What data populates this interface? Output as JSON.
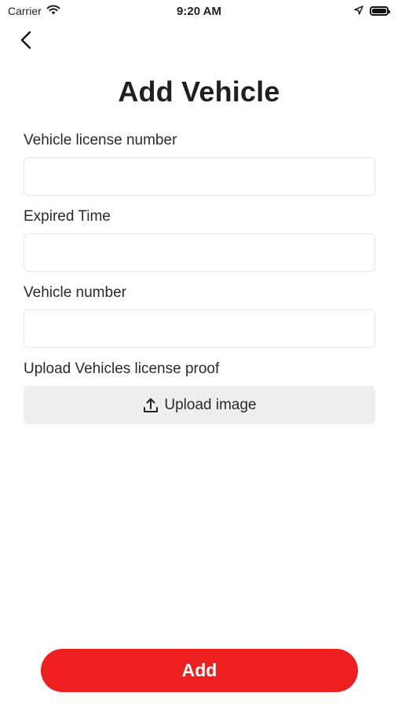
{
  "status_bar": {
    "carrier": "Carrier",
    "time": "9:20 AM",
    "icons": [
      "wifi-icon",
      "location-arrow-icon",
      "battery-icon"
    ]
  },
  "header": {
    "back_icon": "chevron-left-icon",
    "title": "Add Vehicle"
  },
  "form": {
    "license_number": {
      "label": "Vehicle license number",
      "value": "",
      "placeholder": ""
    },
    "expired_time": {
      "label": "Expired Time",
      "value": "",
      "placeholder": ""
    },
    "vehicle_number": {
      "label": "Vehicle number",
      "value": "",
      "placeholder": ""
    },
    "license_proof": {
      "label": "Upload Vehicles license proof",
      "button_label": "Upload image",
      "icon": "upload-icon"
    }
  },
  "footer": {
    "add_label": "Add"
  },
  "colors": {
    "accent": "#ed1f1f",
    "upload_bg": "#eeeeee",
    "input_border": "#e7e7e7",
    "text": "#202020"
  }
}
